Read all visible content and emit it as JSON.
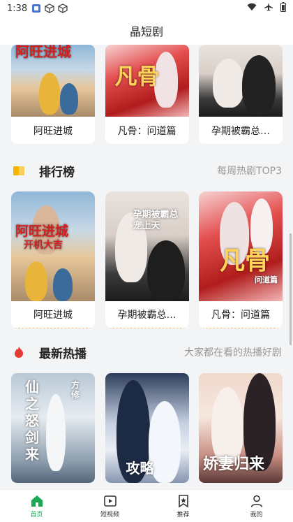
{
  "status": {
    "time": "1:38"
  },
  "app": {
    "title": "晶短剧"
  },
  "section1": {
    "items": [
      {
        "name": "阿旺进城",
        "poster_text": "阿旺进城"
      },
      {
        "name": "凡骨：问道篇",
        "poster_text": "凡骨"
      },
      {
        "name": "孕期被霸总…",
        "poster_text": ""
      }
    ]
  },
  "ranking": {
    "title": "排行榜",
    "subtitle": "每周热剧TOP3",
    "items": [
      {
        "name": "阿旺进城",
        "poster_text": "阿旺进城",
        "poster_sub": "开机大吉"
      },
      {
        "name": "孕期被霸总…",
        "poster_text": "孕期被霸总宠上天",
        "poster_sub": ""
      },
      {
        "name": "凡骨：问道篇",
        "poster_text": "凡骨",
        "poster_sub": "问道篇"
      }
    ]
  },
  "hot": {
    "title": "最新热播",
    "subtitle": "大家都在看的热播好剧",
    "items": [
      {
        "poster_text": "仙之怒剑来",
        "poster_sub": "方修"
      },
      {
        "poster_text": "攻略",
        "poster_sub": ""
      },
      {
        "poster_text": "娇妻归来",
        "poster_sub": ""
      }
    ]
  },
  "nav": [
    {
      "label": "首页",
      "icon": "home-icon",
      "active": true
    },
    {
      "label": "短视频",
      "icon": "play-icon",
      "active": false
    },
    {
      "label": "推荐",
      "icon": "star-icon",
      "active": false
    },
    {
      "label": "我的",
      "icon": "user-icon",
      "active": false
    }
  ],
  "colors": {
    "accent": "#1aaa55",
    "ranking_icon": "#f5b400",
    "hot_icon": "#e53935"
  }
}
